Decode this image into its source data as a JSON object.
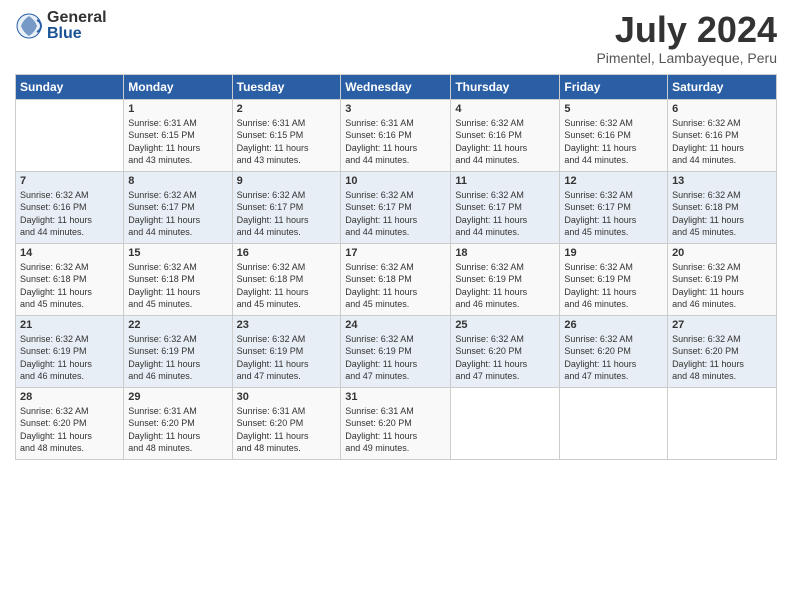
{
  "logo": {
    "general": "General",
    "blue": "Blue"
  },
  "title": "July 2024",
  "location": "Pimentel, Lambayeque, Peru",
  "headers": [
    "Sunday",
    "Monday",
    "Tuesday",
    "Wednesday",
    "Thursday",
    "Friday",
    "Saturday"
  ],
  "weeks": [
    [
      {
        "day": "",
        "info": ""
      },
      {
        "day": "1",
        "info": "Sunrise: 6:31 AM\nSunset: 6:15 PM\nDaylight: 11 hours\nand 43 minutes."
      },
      {
        "day": "2",
        "info": "Sunrise: 6:31 AM\nSunset: 6:15 PM\nDaylight: 11 hours\nand 43 minutes."
      },
      {
        "day": "3",
        "info": "Sunrise: 6:31 AM\nSunset: 6:16 PM\nDaylight: 11 hours\nand 44 minutes."
      },
      {
        "day": "4",
        "info": "Sunrise: 6:32 AM\nSunset: 6:16 PM\nDaylight: 11 hours\nand 44 minutes."
      },
      {
        "day": "5",
        "info": "Sunrise: 6:32 AM\nSunset: 6:16 PM\nDaylight: 11 hours\nand 44 minutes."
      },
      {
        "day": "6",
        "info": "Sunrise: 6:32 AM\nSunset: 6:16 PM\nDaylight: 11 hours\nand 44 minutes."
      }
    ],
    [
      {
        "day": "7",
        "info": "Sunrise: 6:32 AM\nSunset: 6:16 PM\nDaylight: 11 hours\nand 44 minutes."
      },
      {
        "day": "8",
        "info": "Sunrise: 6:32 AM\nSunset: 6:17 PM\nDaylight: 11 hours\nand 44 minutes."
      },
      {
        "day": "9",
        "info": "Sunrise: 6:32 AM\nSunset: 6:17 PM\nDaylight: 11 hours\nand 44 minutes."
      },
      {
        "day": "10",
        "info": "Sunrise: 6:32 AM\nSunset: 6:17 PM\nDaylight: 11 hours\nand 44 minutes."
      },
      {
        "day": "11",
        "info": "Sunrise: 6:32 AM\nSunset: 6:17 PM\nDaylight: 11 hours\nand 44 minutes."
      },
      {
        "day": "12",
        "info": "Sunrise: 6:32 AM\nSunset: 6:17 PM\nDaylight: 11 hours\nand 45 minutes."
      },
      {
        "day": "13",
        "info": "Sunrise: 6:32 AM\nSunset: 6:18 PM\nDaylight: 11 hours\nand 45 minutes."
      }
    ],
    [
      {
        "day": "14",
        "info": "Sunrise: 6:32 AM\nSunset: 6:18 PM\nDaylight: 11 hours\nand 45 minutes."
      },
      {
        "day": "15",
        "info": "Sunrise: 6:32 AM\nSunset: 6:18 PM\nDaylight: 11 hours\nand 45 minutes."
      },
      {
        "day": "16",
        "info": "Sunrise: 6:32 AM\nSunset: 6:18 PM\nDaylight: 11 hours\nand 45 minutes."
      },
      {
        "day": "17",
        "info": "Sunrise: 6:32 AM\nSunset: 6:18 PM\nDaylight: 11 hours\nand 45 minutes."
      },
      {
        "day": "18",
        "info": "Sunrise: 6:32 AM\nSunset: 6:19 PM\nDaylight: 11 hours\nand 46 minutes."
      },
      {
        "day": "19",
        "info": "Sunrise: 6:32 AM\nSunset: 6:19 PM\nDaylight: 11 hours\nand 46 minutes."
      },
      {
        "day": "20",
        "info": "Sunrise: 6:32 AM\nSunset: 6:19 PM\nDaylight: 11 hours\nand 46 minutes."
      }
    ],
    [
      {
        "day": "21",
        "info": "Sunrise: 6:32 AM\nSunset: 6:19 PM\nDaylight: 11 hours\nand 46 minutes."
      },
      {
        "day": "22",
        "info": "Sunrise: 6:32 AM\nSunset: 6:19 PM\nDaylight: 11 hours\nand 46 minutes."
      },
      {
        "day": "23",
        "info": "Sunrise: 6:32 AM\nSunset: 6:19 PM\nDaylight: 11 hours\nand 47 minutes."
      },
      {
        "day": "24",
        "info": "Sunrise: 6:32 AM\nSunset: 6:19 PM\nDaylight: 11 hours\nand 47 minutes."
      },
      {
        "day": "25",
        "info": "Sunrise: 6:32 AM\nSunset: 6:20 PM\nDaylight: 11 hours\nand 47 minutes."
      },
      {
        "day": "26",
        "info": "Sunrise: 6:32 AM\nSunset: 6:20 PM\nDaylight: 11 hours\nand 47 minutes."
      },
      {
        "day": "27",
        "info": "Sunrise: 6:32 AM\nSunset: 6:20 PM\nDaylight: 11 hours\nand 48 minutes."
      }
    ],
    [
      {
        "day": "28",
        "info": "Sunrise: 6:32 AM\nSunset: 6:20 PM\nDaylight: 11 hours\nand 48 minutes."
      },
      {
        "day": "29",
        "info": "Sunrise: 6:31 AM\nSunset: 6:20 PM\nDaylight: 11 hours\nand 48 minutes."
      },
      {
        "day": "30",
        "info": "Sunrise: 6:31 AM\nSunset: 6:20 PM\nDaylight: 11 hours\nand 48 minutes."
      },
      {
        "day": "31",
        "info": "Sunrise: 6:31 AM\nSunset: 6:20 PM\nDaylight: 11 hours\nand 49 minutes."
      },
      {
        "day": "",
        "info": ""
      },
      {
        "day": "",
        "info": ""
      },
      {
        "day": "",
        "info": ""
      }
    ]
  ]
}
